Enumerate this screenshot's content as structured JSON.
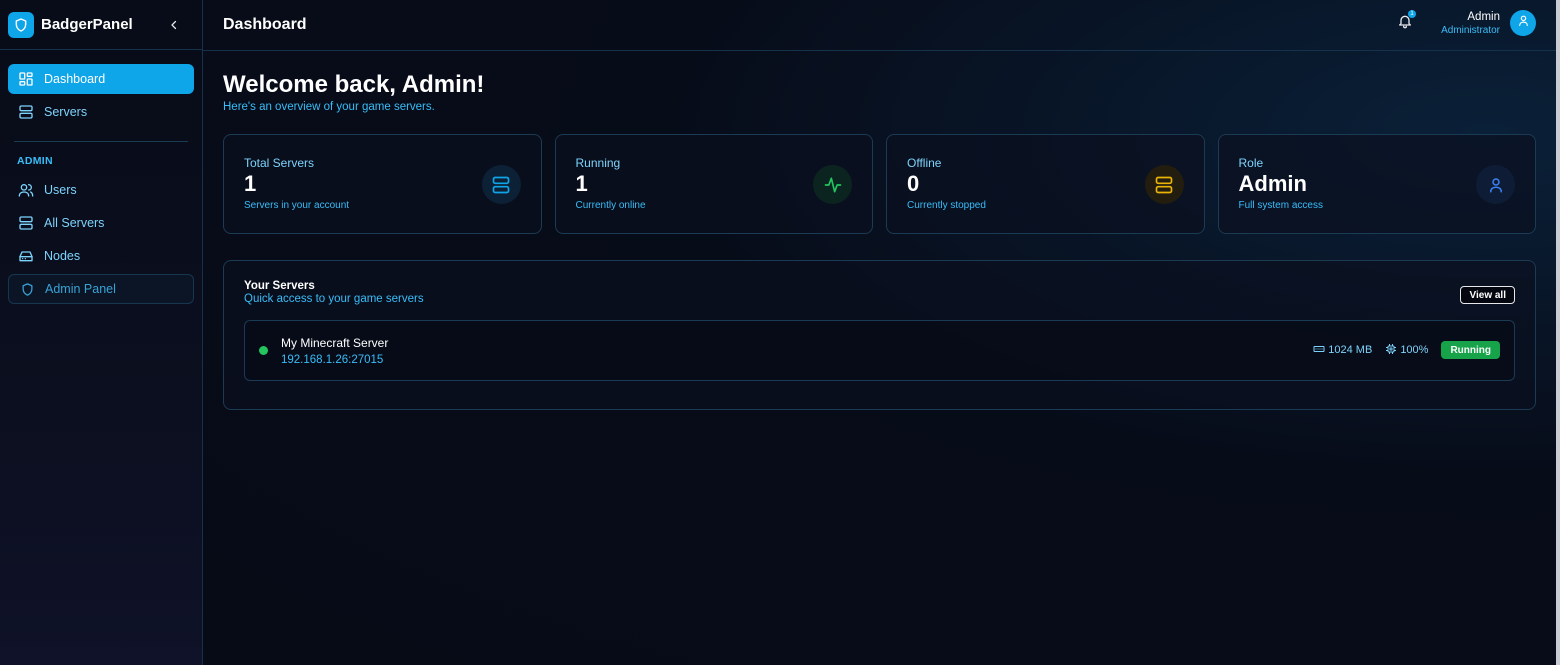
{
  "brand": {
    "name": "BadgerPanel"
  },
  "sidebar": {
    "items": [
      {
        "label": "Dashboard",
        "icon": "dashboard-icon",
        "active": true
      },
      {
        "label": "Servers",
        "icon": "server-icon",
        "active": false
      }
    ],
    "admin_section": "ADMIN",
    "admin_items": [
      {
        "label": "Users",
        "icon": "users-icon"
      },
      {
        "label": "All Servers",
        "icon": "server-icon"
      },
      {
        "label": "Nodes",
        "icon": "hard-drive-icon"
      },
      {
        "label": "Admin Panel",
        "icon": "shield-icon"
      }
    ]
  },
  "header": {
    "title": "Dashboard",
    "notification_count": "1",
    "user_name": "Admin",
    "user_role": "Administrator"
  },
  "welcome": {
    "title": "Welcome back, Admin!",
    "subtitle": "Here's an overview of your game servers."
  },
  "stats": [
    {
      "label": "Total Servers",
      "value": "1",
      "desc": "Servers in your account",
      "icon": "server-icon",
      "color": "#0ea5e9"
    },
    {
      "label": "Running",
      "value": "1",
      "desc": "Currently online",
      "icon": "activity-icon",
      "color": "#22c55e"
    },
    {
      "label": "Offline",
      "value": "0",
      "desc": "Currently stopped",
      "icon": "server-icon",
      "color": "#eab308"
    },
    {
      "label": "Role",
      "value": "Admin",
      "desc": "Full system access",
      "icon": "user-icon",
      "color": "#3b82f6"
    }
  ],
  "servers": {
    "title": "Your Servers",
    "subtitle": "Quick access to your game servers",
    "view_all": "View all",
    "list": [
      {
        "name": "My Minecraft Server",
        "address": "192.168.1.26:27015",
        "memory": "1024 MB",
        "cpu": "100%",
        "status": "Running"
      }
    ]
  },
  "colors": {
    "accent": "#0ea5e9",
    "success": "#22c55e",
    "warning": "#eab308",
    "background": "#070b16"
  }
}
